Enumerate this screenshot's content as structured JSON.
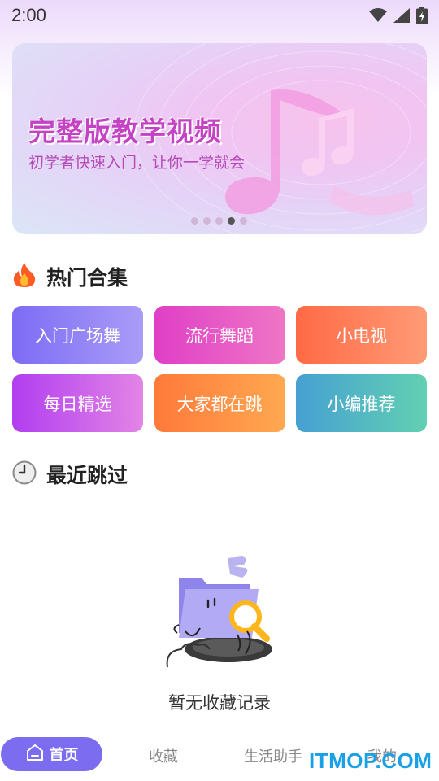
{
  "status_bar": {
    "time": "2:00",
    "icons": [
      "wifi-icon",
      "cellular-signal-icon",
      "battery-charging-icon"
    ]
  },
  "banner": {
    "title": "完整版教学视频",
    "subtitle": "初学者快速入门，让你一学就会",
    "slide_count": 5,
    "active_slide": 4,
    "title_color": "#c443c4"
  },
  "hot_section": {
    "icon": "fire-icon",
    "title": "热门合集",
    "tiles": [
      {
        "label": "入门广场舞",
        "gradient": [
          "#7d6cf5",
          "#a99cf7"
        ]
      },
      {
        "label": "流行舞蹈",
        "gradient": [
          "#e03fc6",
          "#ee76c6"
        ]
      },
      {
        "label": "小电视",
        "gradient": [
          "#ff6a45",
          "#ff9b76"
        ]
      },
      {
        "label": "每日精选",
        "gradient": [
          "#b13ef0",
          "#e384e6"
        ]
      },
      {
        "label": "大家都在跳",
        "gradient": [
          "#ff7a3a",
          "#ffa851"
        ]
      },
      {
        "label": "小编推荐",
        "gradient": [
          "#46a0d2",
          "#62d0b2"
        ]
      }
    ]
  },
  "recent_section": {
    "icon": "clock-icon",
    "title": "最近跳过",
    "empty_text": "暂无收藏记录"
  },
  "bottom_nav": {
    "home": "首页",
    "favorites": "收藏",
    "life_assistant": "生活助手",
    "mine": "我的",
    "active_color": "#7b6cf0"
  },
  "watermark": "ITMOP.COM"
}
